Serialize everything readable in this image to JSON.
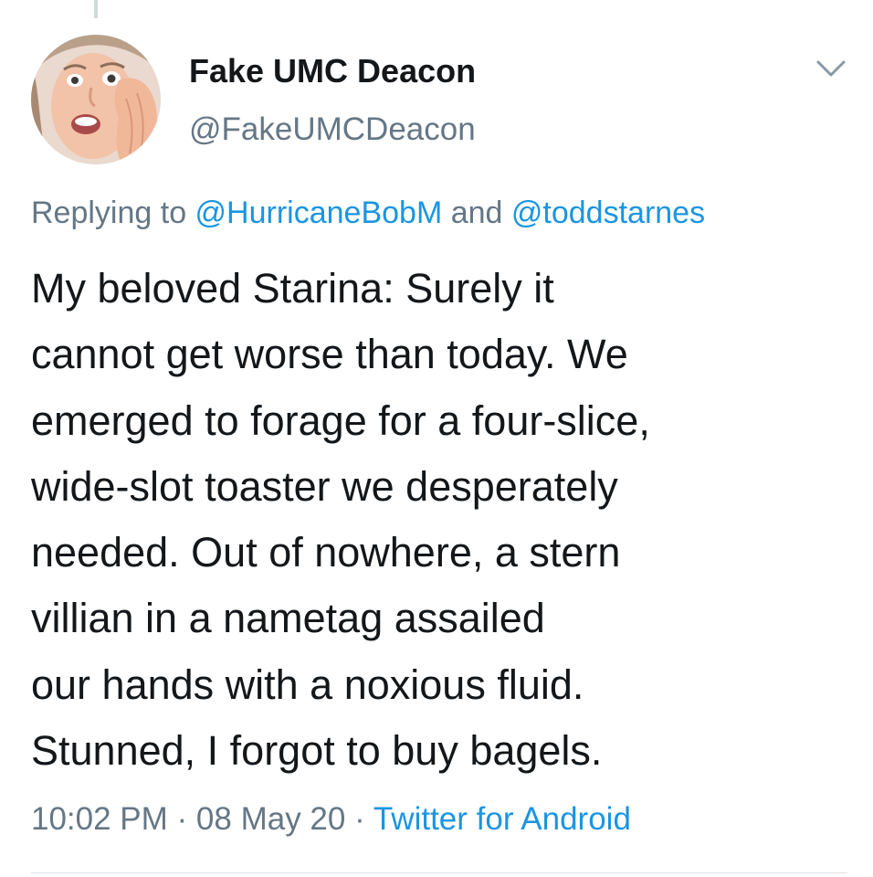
{
  "user": {
    "display_name": "Fake UMC Deacon",
    "handle": "@FakeUMCDeacon"
  },
  "header": {
    "caret_icon": "chevron-down-icon"
  },
  "reply": {
    "prefix": "Replying to ",
    "mention_1": "@HurricaneBobM",
    "conjunction": " and ",
    "mention_2": "@toddstarnes"
  },
  "tweet": {
    "lines": [
      "My beloved Starina: Surely it",
      "cannot get worse than today. We",
      "emerged to forage for a four-slice,",
      "wide-slot toaster we desperately",
      "needed. Out of nowhere, a stern",
      "villian in a nametag assailed",
      "our hands with a noxious fluid.",
      "Stunned, I forgot to buy bagels."
    ]
  },
  "meta": {
    "time": "10:02 PM",
    "sep1": " · ",
    "date": "08 May 20",
    "sep2": " · ",
    "source": "Twitter for Android"
  },
  "colors": {
    "link": "#1b95e0",
    "muted": "#657786",
    "text": "#14171a"
  }
}
